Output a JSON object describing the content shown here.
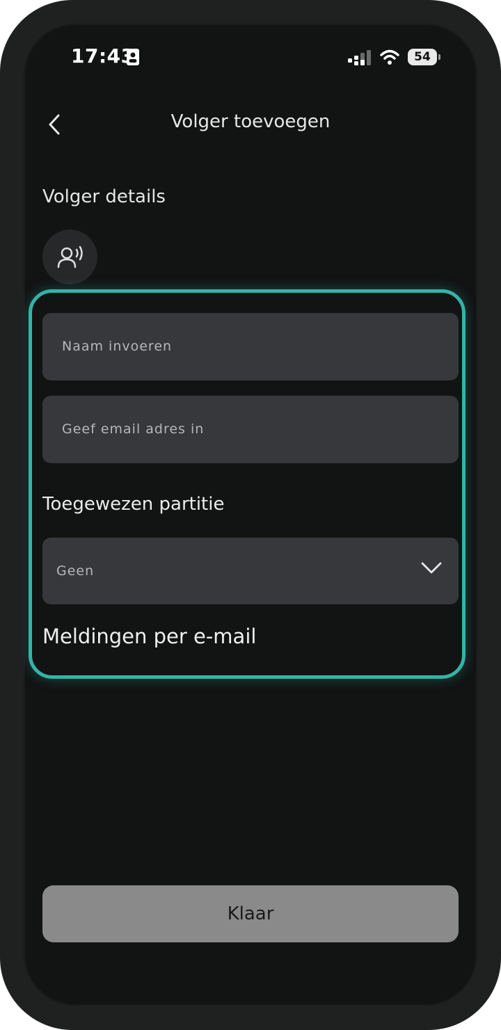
{
  "status_bar": {
    "time": "17:43",
    "battery": "54"
  },
  "header": {
    "title": "Volger toevoegen"
  },
  "details": {
    "heading": "Volger details",
    "name_placeholder": "Naam invoeren",
    "email_placeholder": "Geef email adres in"
  },
  "partition": {
    "heading": "Toegewezen partitie",
    "selected": "Geen"
  },
  "notifications": {
    "heading": "Meldingen per e-mail"
  },
  "actions": {
    "done_label": "Klaar"
  },
  "colors": {
    "accent": "#35b3a8",
    "background": "#121313",
    "field": "#36383b",
    "button": "#8a8a8a"
  }
}
